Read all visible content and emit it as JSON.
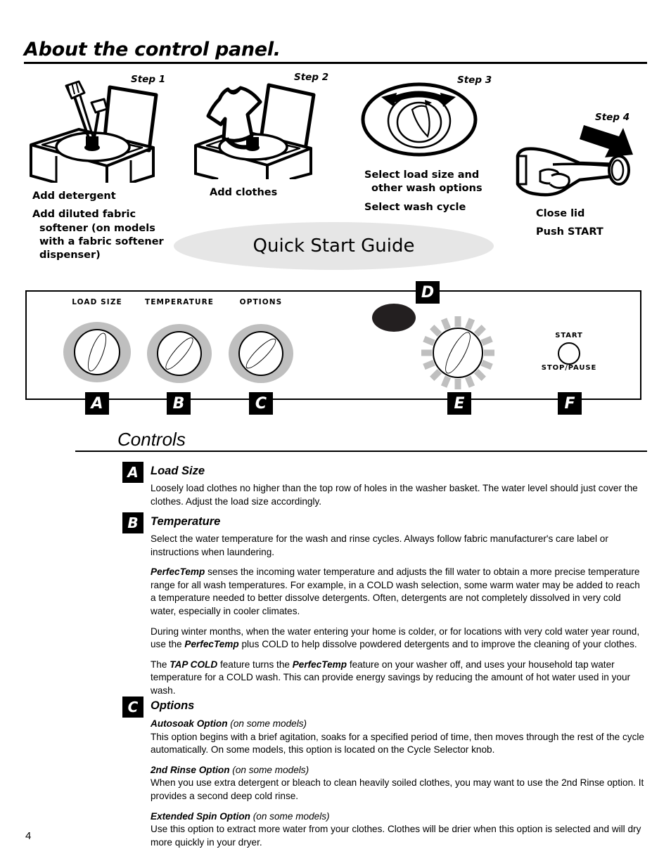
{
  "page": {
    "title": "About the control panel.",
    "number": "4"
  },
  "quick_start": {
    "banner": "Quick Start Guide",
    "steps": [
      {
        "label": "Step 1",
        "icon": "washer-add-detergent-icon",
        "bullets": [
          "Add detergent",
          "Add diluted fabric softener (on models with a fabric softener dispenser)"
        ]
      },
      {
        "label": "Step 2",
        "icon": "washer-add-clothes-icon",
        "bullets": [
          "Add clothes"
        ]
      },
      {
        "label": "Step 3",
        "icon": "rotate-knob-icon",
        "bullets": [
          "Select load size and other wash options",
          "Select wash cycle"
        ]
      },
      {
        "label": "Step 4",
        "icon": "hand-push-start-icon",
        "bullets": [
          "Close lid",
          "Push START"
        ]
      }
    ]
  },
  "control_panel": {
    "knobs": [
      {
        "caption": "LOAD SIZE",
        "callout": "A"
      },
      {
        "caption": "TEMPERATURE",
        "callout": "B"
      },
      {
        "caption": "OPTIONS",
        "callout": "C"
      }
    ],
    "display_callout": "D",
    "cycle_selector_callout": "E",
    "start_button": {
      "top_label": "START",
      "bottom_label": "STOP/PAUSE",
      "callout": "F"
    },
    "colors": {
      "knob_halo": "#bfbfbf",
      "display": "#231f20",
      "panel_border": "#000000"
    }
  },
  "controls": {
    "heading": "Controls",
    "sections": [
      {
        "badge": "A",
        "title": "Load Size",
        "paragraphs": [
          [
            {
              "t": "Loosely load clothes no higher than the top row of holes in the washer basket. The water level should just cover the clothes. Adjust the load size accordingly."
            }
          ]
        ]
      },
      {
        "badge": "B",
        "title": "Temperature",
        "paragraphs": [
          [
            {
              "t": "Select the water temperature for the wash and rinse cycles. Always follow fabric manufacturer's care label or instructions when laundering."
            }
          ],
          [
            {
              "t": "PerfecTemp",
              "s": "bi"
            },
            {
              "t": " senses the incoming water temperature and adjusts the fill water to obtain a more precise temperature range for all wash temperatures. For example, in a COLD wash selection, some warm water may be added to reach a temperature needed to better dissolve detergents. Often, detergents are not completely dissolved in very cold water, especially in cooler climates."
            }
          ],
          [
            {
              "t": "During winter months, when the water entering your home is colder, or for locations with very cold water year round, use the "
            },
            {
              "t": "PerfecTemp",
              "s": "bi"
            },
            {
              "t": " plus COLD to help dissolve powdered detergents and to improve the cleaning of your clothes."
            }
          ],
          [
            {
              "t": "The "
            },
            {
              "t": "TAP COLD",
              "s": "bi"
            },
            {
              "t": " feature turns the "
            },
            {
              "t": "PerfecTemp",
              "s": "bi"
            },
            {
              "t": " feature on your washer off, and uses your household tap water temperature for a COLD wash. This can provide energy savings by reducing the amount of hot water used in your wash."
            }
          ]
        ]
      },
      {
        "badge": "C",
        "title": "Options",
        "options": [
          {
            "name": "Autosoak Option",
            "note": "(on some models)",
            "body": "This option begins with a brief agitation, soaks for a specified period of time, then moves through the rest of the cycle automatically. On some models, this option is located on the Cycle Selector knob."
          },
          {
            "name": "2nd Rinse Option",
            "note": "(on some models)",
            "body": "When you use extra detergent or bleach to clean heavily soiled clothes, you may want to use the 2nd Rinse option. It provides a second deep cold rinse."
          },
          {
            "name": "Extended Spin Option",
            "note": "(on some models)",
            "body": "Use this option to extract more water from your clothes. Clothes will be drier when this option is selected and will dry more quickly in your dryer."
          }
        ]
      }
    ]
  }
}
